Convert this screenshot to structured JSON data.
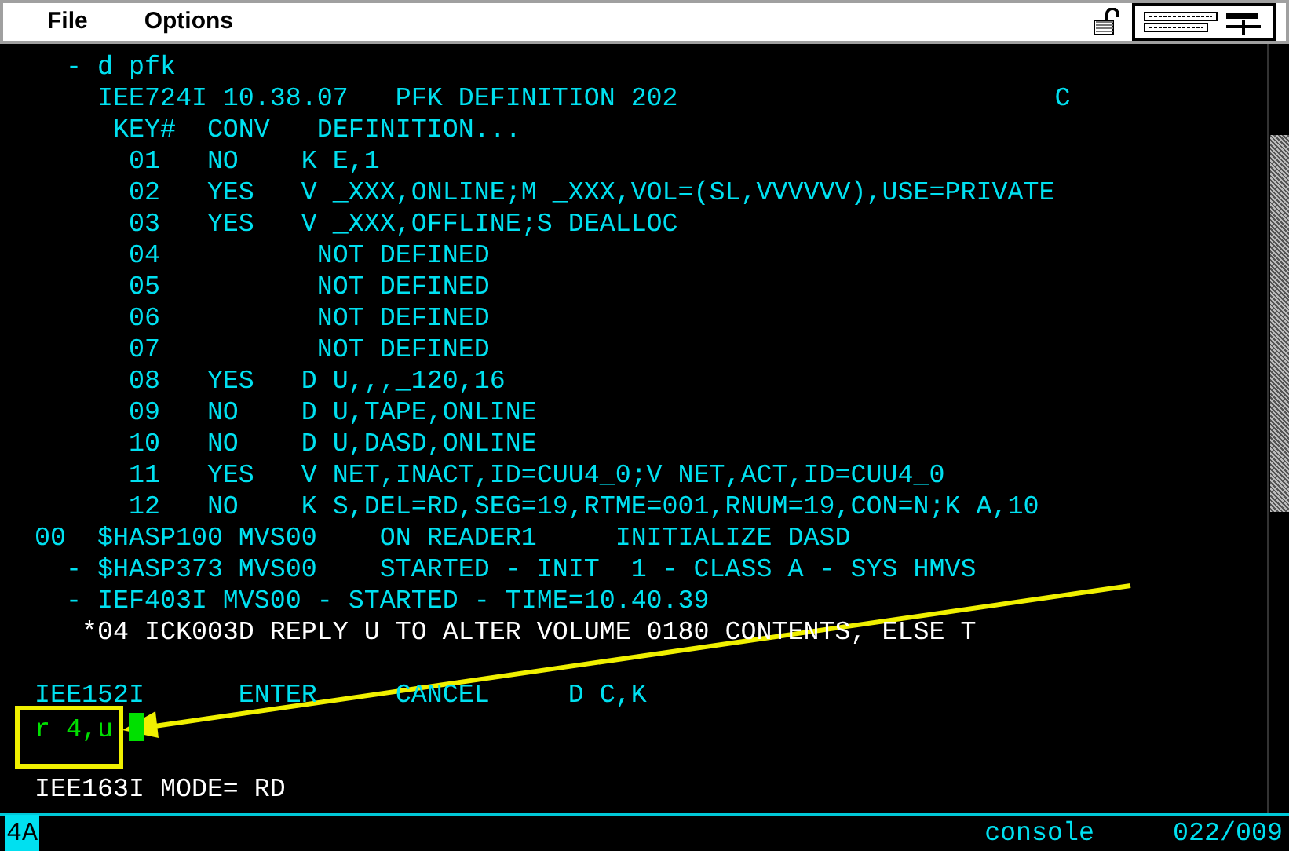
{
  "menu": [
    {
      "label": "File"
    },
    {
      "label": "Options"
    }
  ],
  "terminal": {
    "lines": [
      {
        "kind": "text",
        "text": "    - d pfk",
        "color": "#00e0f0"
      },
      {
        "kind": "text",
        "text": "      IEE724I 10.38.07   PFK DEFINITION 202                        C",
        "color": "#00e0f0"
      },
      {
        "kind": "text",
        "text": "       KEY#  CONV   DEFINITION...",
        "color": "#00e0f0"
      },
      {
        "kind": "text",
        "text": "        01   NO    K E,1",
        "color": "#00e0f0"
      },
      {
        "kind": "text",
        "text": "        02   YES   V _XXX,ONLINE;M _XXX,VOL=(SL,VVVVVV),USE=PRIVATE",
        "color": "#00e0f0"
      },
      {
        "kind": "text",
        "text": "        03   YES   V _XXX,OFFLINE;S DEALLOC",
        "color": "#00e0f0"
      },
      {
        "kind": "text",
        "text": "        04          NOT DEFINED",
        "color": "#00e0f0"
      },
      {
        "kind": "text",
        "text": "        05          NOT DEFINED",
        "color": "#00e0f0"
      },
      {
        "kind": "text",
        "text": "        06          NOT DEFINED",
        "color": "#00e0f0"
      },
      {
        "kind": "text",
        "text": "        07          NOT DEFINED",
        "color": "#00e0f0"
      },
      {
        "kind": "text",
        "text": "        08   YES   D U,,,_120,16",
        "color": "#00e0f0"
      },
      {
        "kind": "text",
        "text": "        09   NO    D U,TAPE,ONLINE",
        "color": "#00e0f0"
      },
      {
        "kind": "text",
        "text": "        10   NO    D U,DASD,ONLINE",
        "color": "#00e0f0"
      },
      {
        "kind": "text",
        "text": "        11   YES   V NET,INACT,ID=CUU4_0;V NET,ACT,ID=CUU4_0",
        "color": "#00e0f0"
      },
      {
        "kind": "text",
        "text": "        12   NO    K S,DEL=RD,SEG=19,RTME=001,RNUM=19,CON=N;K A,10",
        "color": "#00e0f0"
      },
      {
        "kind": "text",
        "text": "  00  $HASP100 MVS00    ON READER1     INITIALIZE DASD",
        "color": "#00e0f0"
      },
      {
        "kind": "text",
        "text": "    - $HASP373 MVS00    STARTED - INIT  1 - CLASS A - SYS HMVS",
        "color": "#00e0f0"
      },
      {
        "kind": "text",
        "text": "    - IEF403I MVS00 - STARTED - TIME=10.40.39",
        "color": "#00e0f0"
      },
      {
        "kind": "text",
        "text": "     *04 ICK003D REPLY U TO ALTER VOLUME 0180 CONTENTS, ELSE T",
        "color": "#ffffff"
      },
      {
        "kind": "blank"
      },
      {
        "kind": "text",
        "text": "  IEE152I      ENTER     CANCEL     D C,K",
        "color": "#00e0f0"
      },
      {
        "kind": "input",
        "text": "r 4,u",
        "color": "#00e000"
      },
      {
        "kind": "blank"
      },
      {
        "kind": "text",
        "text": "  IEE163I MODE= RD",
        "color": "#ffffff"
      }
    ]
  },
  "status_bar": {
    "indicator": "4A",
    "session": "console",
    "position": "022/009"
  }
}
